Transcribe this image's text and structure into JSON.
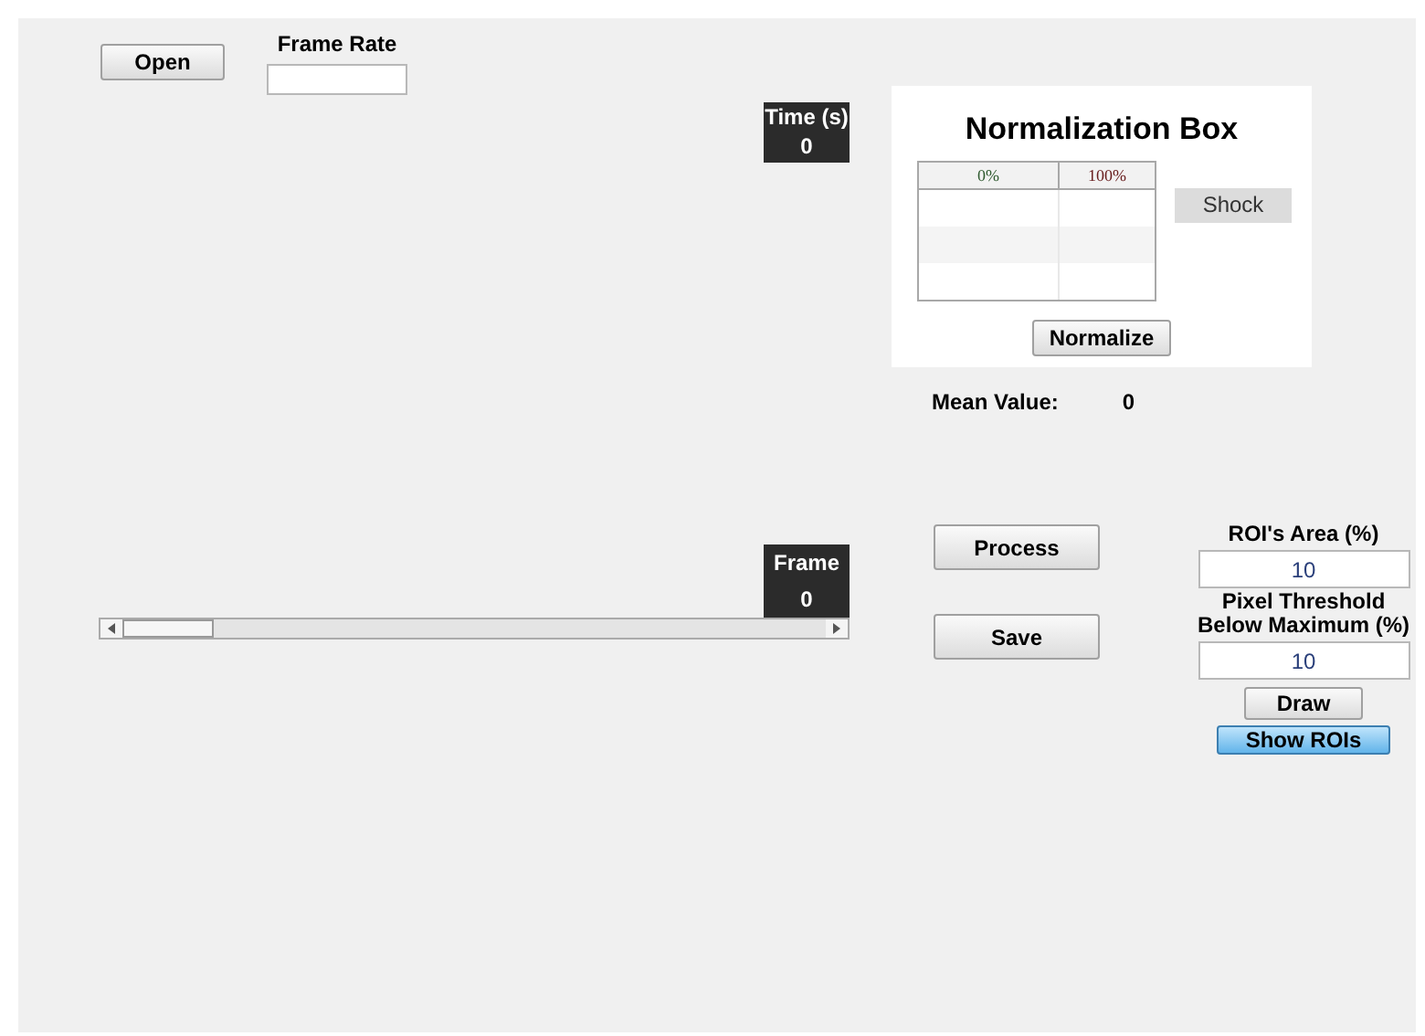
{
  "open_button": "Open",
  "frame_rate": {
    "label": "Frame Rate"
  },
  "time_display": {
    "label": "Time (s)",
    "value": "0"
  },
  "frame_display": {
    "label": "Frame",
    "value": "0"
  },
  "frame_slider": {
    "level": 0
  },
  "normalization_box": {
    "title": "Normalization Box",
    "columns": [
      "0%",
      "100%"
    ],
    "shock_label": "Shock",
    "button": "Normalize"
  },
  "mean_value": {
    "label": "Mean Value:",
    "value": "0"
  },
  "buttons": [
    "Process",
    "Save"
  ],
  "roi_area": {
    "label": "ROI's Area (%)",
    "value": "10"
  },
  "pixel_threshold": {
    "label": "Pixel Threshold Below Maximum (%)",
    "value": "10"
  },
  "draw_button": "Draw",
  "show_rois": {
    "label": "Show ROIs",
    "selected": true
  }
}
